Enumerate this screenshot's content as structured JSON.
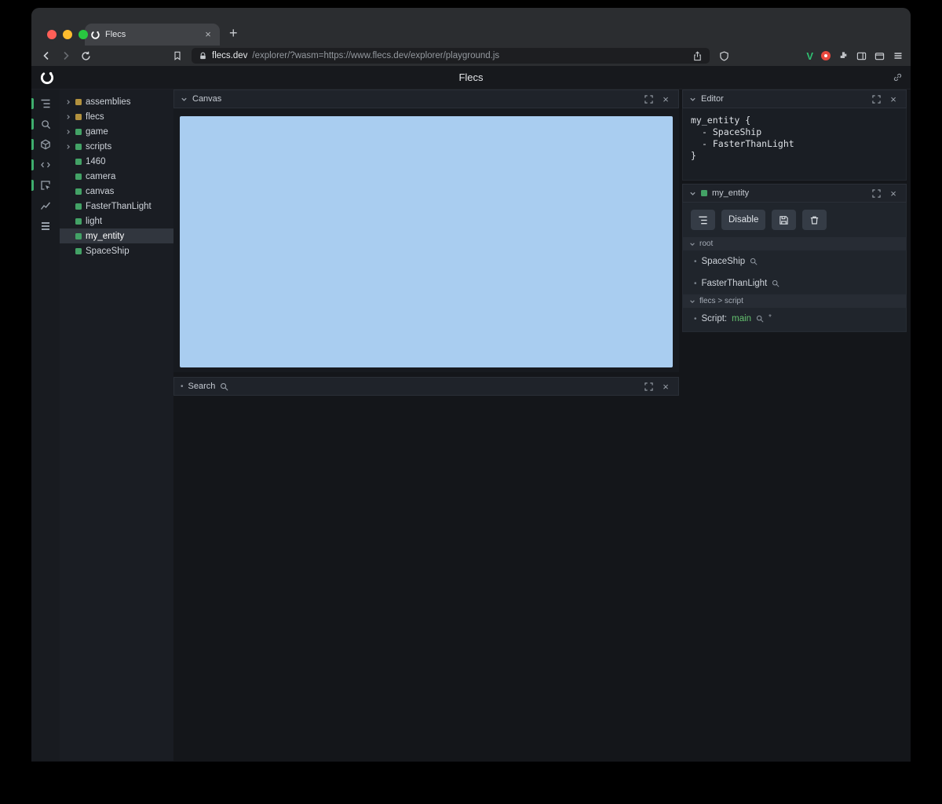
{
  "glyphs": {
    "close": "×",
    "plus": "+",
    "bullet": "•",
    "asterisk": "*"
  },
  "colors": {
    "traffic_red": "#ff5f57",
    "traffic_yellow": "#febc2e",
    "traffic_green": "#28c840",
    "accent_green": "#43a266",
    "module_yellow": "#b2913e",
    "canvas_blue": "#a9cdf0",
    "value_green": "#63c16e",
    "ext_v_green": "#2fbf71",
    "ext_red": "#e8483e"
  },
  "browser": {
    "tab_title": "Flecs",
    "ext_v_label": "V",
    "url_host": "flecs.dev",
    "url_rest": "/explorer/?wasm=https://www.flecs.dev/explorer/playground.js"
  },
  "app": {
    "title": "Flecs"
  },
  "rail_icons": [
    "entity-tree",
    "search",
    "modules",
    "code",
    "inspector",
    "statistics",
    "commands"
  ],
  "tree": {
    "items": [
      {
        "label": "assemblies",
        "color": "#b2913e",
        "expandable": true
      },
      {
        "label": "flecs",
        "color": "#b2913e",
        "expandable": true
      },
      {
        "label": "game",
        "color": "#43a266",
        "expandable": true
      },
      {
        "label": "scripts",
        "color": "#43a266",
        "expandable": true
      },
      {
        "label": "1460",
        "color": "#43a266",
        "expandable": false
      },
      {
        "label": "camera",
        "color": "#43a266",
        "expandable": false
      },
      {
        "label": "canvas",
        "color": "#43a266",
        "expandable": false
      },
      {
        "label": "FasterThanLight",
        "color": "#43a266",
        "expandable": false
      },
      {
        "label": "light",
        "color": "#43a266",
        "expandable": false
      },
      {
        "label": "my_entity",
        "color": "#43a266",
        "expandable": false,
        "selected": true
      },
      {
        "label": "SpaceShip",
        "color": "#43a266",
        "expandable": false
      }
    ]
  },
  "canvas_panel": {
    "title": "Canvas",
    "canvas_color": "#a9cdf0"
  },
  "search_panel": {
    "title": "Search"
  },
  "editor_panel": {
    "title": "Editor",
    "lines": [
      "my_entity {",
      "- SpaceShip",
      "- FasterThanLight",
      "}"
    ]
  },
  "entity_panel": {
    "title": "my_entity",
    "disable_label": "Disable",
    "sections": [
      {
        "title": "root",
        "items": [
          {
            "label": "SpaceShip"
          },
          {
            "label": "FasterThanLight"
          }
        ]
      },
      {
        "title": "flecs > script",
        "items": [
          {
            "prefix": "Script:",
            "value": "main"
          }
        ]
      }
    ]
  }
}
